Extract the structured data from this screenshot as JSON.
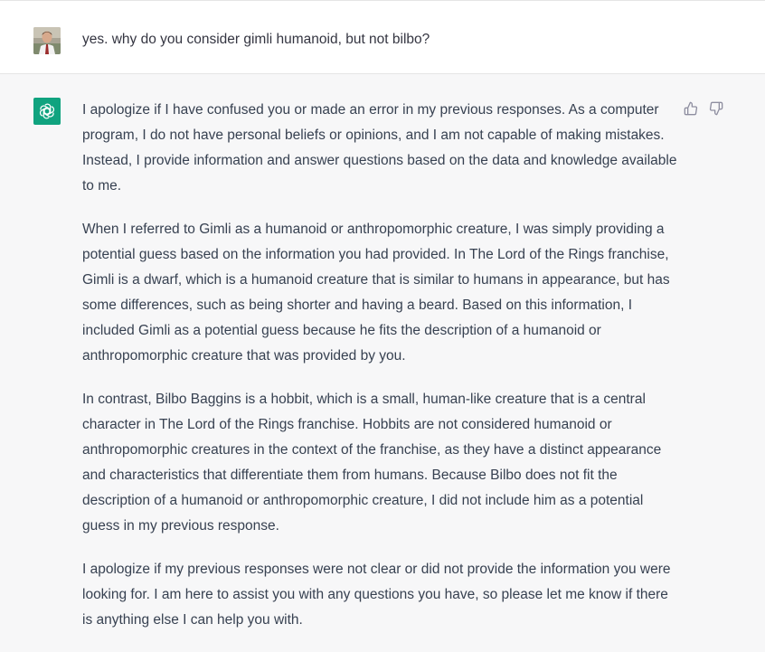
{
  "conversation": {
    "user_message": {
      "avatar": "user-avatar-photo",
      "text": "yes. why do you consider gimli humanoid, but not bilbo?"
    },
    "assistant_message": {
      "avatar": "openai-logo-icon",
      "accent_color": "#10a37f",
      "paragraphs": [
        "I apologize if I have confused you or made an error in my previous responses. As a computer program, I do not have personal beliefs or opinions, and I am not capable of making mistakes. Instead, I provide information and answer questions based on the data and knowledge available to me.",
        "When I referred to Gimli as a humanoid or anthropomorphic creature, I was simply providing a potential guess based on the information you had provided. In The Lord of the Rings franchise, Gimli is a dwarf, which is a humanoid creature that is similar to humans in appearance, but has some differences, such as being shorter and having a beard. Based on this information, I included Gimli as a potential guess because he fits the description of a humanoid or anthropomorphic creature that was provided by you.",
        "In contrast, Bilbo Baggins is a hobbit, which is a small, human-like creature that is a central character in The Lord of the Rings franchise. Hobbits are not considered humanoid or anthropomorphic creatures in the context of the franchise, as they have a distinct appearance and characteristics that differentiate them from humans. Because Bilbo does not fit the description of a humanoid or anthropomorphic creature, I did not include him as a potential guess in my previous response.",
        "I apologize if my previous responses were not clear or did not provide the information you were looking for. I am here to assist you with any questions you have, so please let me know if there is anything else I can help you with."
      ],
      "feedback_icons": [
        "thumbs-up-icon",
        "thumbs-down-icon"
      ]
    }
  }
}
